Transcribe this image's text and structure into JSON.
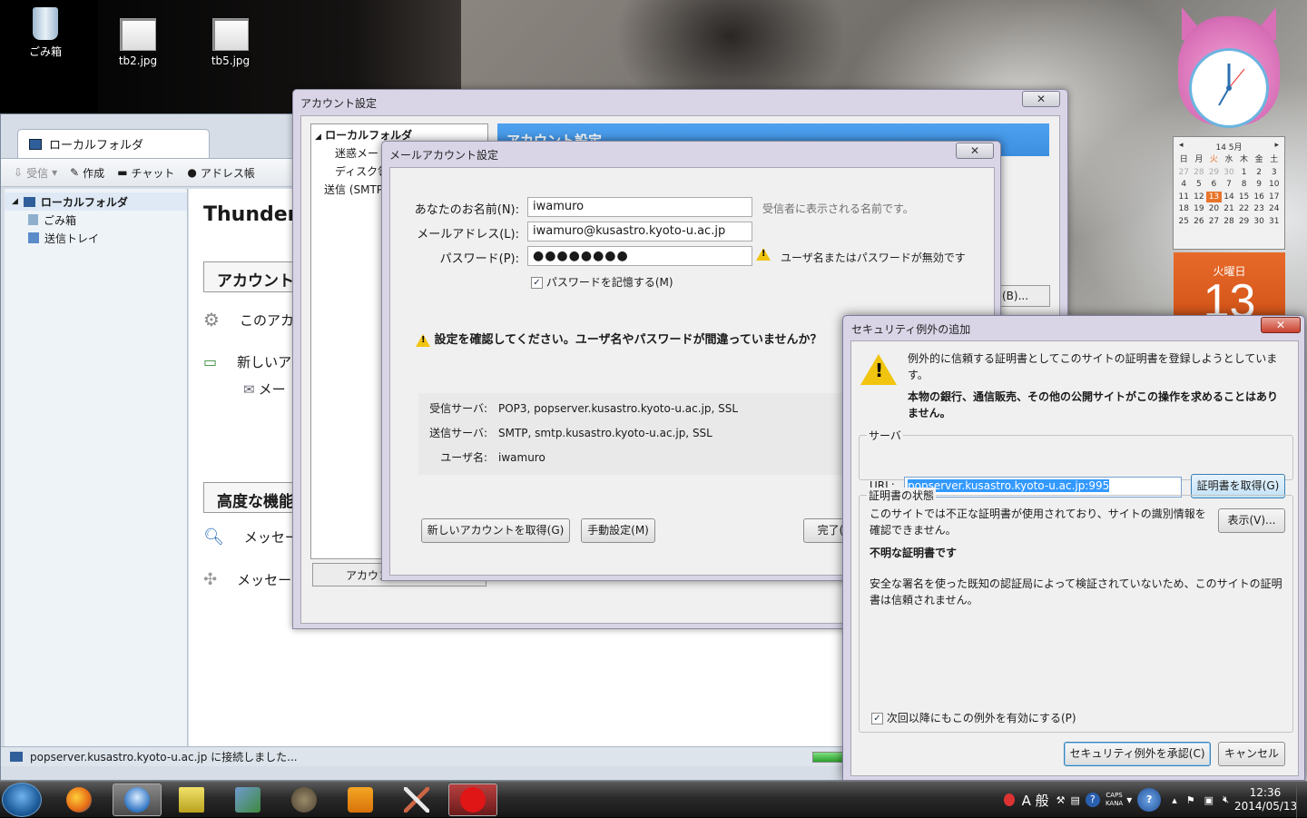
{
  "desktop": {
    "icons": [
      {
        "label": "ごみ箱"
      },
      {
        "label": "tb2.jpg"
      },
      {
        "label": "tb5.jpg"
      }
    ],
    "calendar": {
      "month": "14 5月",
      "weekdays": [
        "日",
        "月",
        "火",
        "水",
        "木",
        "金",
        "土"
      ],
      "days": [
        "27",
        "28",
        "29",
        "30",
        "1",
        "2",
        "3",
        "4",
        "5",
        "6",
        "7",
        "8",
        "9",
        "10",
        "11",
        "12",
        "13",
        "14",
        "15",
        "16",
        "17",
        "18",
        "19",
        "20",
        "21",
        "22",
        "23",
        "24",
        "25",
        "26",
        "27",
        "28",
        "29",
        "30",
        "31"
      ],
      "weekday_label": "火曜日",
      "day": "13"
    }
  },
  "thunderbird": {
    "tab_label": "ローカルフォルダ",
    "toolbar": {
      "receive": "受信",
      "compose": "作成",
      "chat": "チャット",
      "addressbook": "アドレス帳"
    },
    "folders": [
      {
        "label": "ローカルフォルダ"
      },
      {
        "label": "ごみ箱"
      },
      {
        "label": "送信トレイ"
      }
    ],
    "content": {
      "heading": "Thunder",
      "accounts_header": "アカウント",
      "this_account": "このアカ",
      "new_account": "新しいア",
      "mail": "メー",
      "advanced_header": "高度な機能",
      "search_messages": "メッセー",
      "filter_messages": "メッセー"
    },
    "status": "popserver.kusastro.kyoto-u.ac.jp に接続しました..."
  },
  "account_settings": {
    "title": "アカウント設定",
    "tree": [
      "ローカルフォルダ",
      "迷惑メー",
      "ディスク領",
      "送信 (SMTP"
    ],
    "header": "アカウント設定",
    "actions_button": "アカウン",
    "more_button": "(B)..."
  },
  "mail_setup": {
    "title": "メールアカウント設定",
    "name_label": "あなたのお名前(N):",
    "name_value": "iwamuro",
    "name_hint": "受信者に表示される名前です。",
    "email_label": "メールアドレス(L):",
    "email_value": "iwamuro@kusastro.kyoto-u.ac.jp",
    "password_label": "パスワード(P):",
    "password_value": "●●●●●●●●",
    "password_warning": "ユーザ名またはパスワードが無効です",
    "remember_label": "パスワードを記憶する(M)",
    "remember_checked": true,
    "alert": "設定を確認してください。ユーザ名やパスワードが間違っていませんか？",
    "summary": [
      {
        "key": "受信サーバ:",
        "value": "POP3, popserver.kusastro.kyoto-u.ac.jp, SSL"
      },
      {
        "key": "送信サーバ:",
        "value": "SMTP, smtp.kusastro.kyoto-u.ac.jp, SSL"
      },
      {
        "key": "ユーザ名:",
        "value": "iwamuro"
      }
    ],
    "new_account_button": "新しいアカウントを取得(G)",
    "manual_button": "手動設定(M)",
    "done_button": "完了("
  },
  "security_exception": {
    "title": "セキュリティ例外の追加",
    "message1": "例外的に信頼する証明書としてこのサイトの証明書を登録しようとしています。",
    "message2": "本物の銀行、通信販売、その他の公開サイトがこの操作を求めることはありません。",
    "server_group": "サーバ",
    "url_label": "URL:",
    "url_value": "popserver.kusastro.kyoto-u.ac.jp:995",
    "get_cert_button": "証明書を取得(G)",
    "cert_status_group": "証明書の状態",
    "status_text": "このサイトでは不正な証明書が使用されており、サイトの識別情報を確認できません。",
    "view_button": "表示(V)...",
    "unknown_cert": "不明な証明書です",
    "untrusted_text": "安全な署名を使った既知の認証局によって検証されていないため、このサイトの証明書は信頼されません。",
    "permanent_label": "次回以降にもこの例外を有効にする(P)",
    "permanent_checked": true,
    "confirm_button": "セキュリティ例外を承認(C)",
    "cancel_button": "キャンセル"
  },
  "taskbar": {
    "ime": "A 般",
    "caps": "CAPS",
    "kana": "KANA",
    "time": "12:36",
    "date": "2014/05/13"
  }
}
